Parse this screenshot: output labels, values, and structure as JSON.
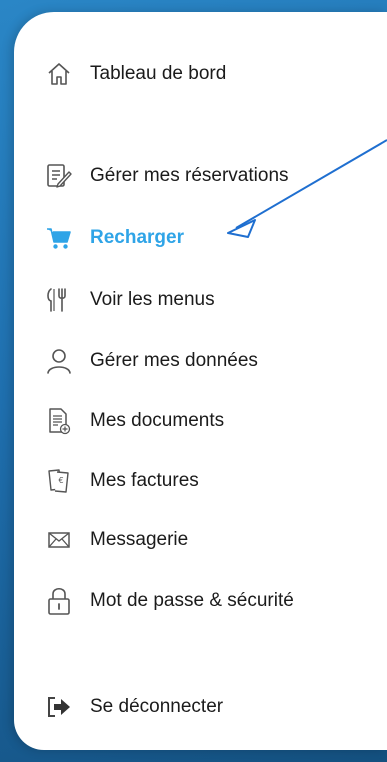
{
  "accent_color": "#2fa4e7",
  "menu": {
    "items": [
      {
        "label": "Tableau de bord",
        "icon": "home-icon"
      },
      {
        "label": "Gérer mes réservations",
        "icon": "edit-document-icon"
      },
      {
        "label": "Recharger",
        "icon": "cart-icon",
        "active": true
      },
      {
        "label": "Voir les menus",
        "icon": "cutlery-icon"
      },
      {
        "label": "Gérer mes données",
        "icon": "user-icon"
      },
      {
        "label": "Mes documents",
        "icon": "document-icon"
      },
      {
        "label": "Mes factures",
        "icon": "receipt-icon"
      },
      {
        "label": "Messagerie",
        "icon": "mail-icon"
      },
      {
        "label": "Mot de passe & sécurité",
        "icon": "lock-icon"
      },
      {
        "label": "Se déconnecter",
        "icon": "logout-icon"
      }
    ]
  }
}
